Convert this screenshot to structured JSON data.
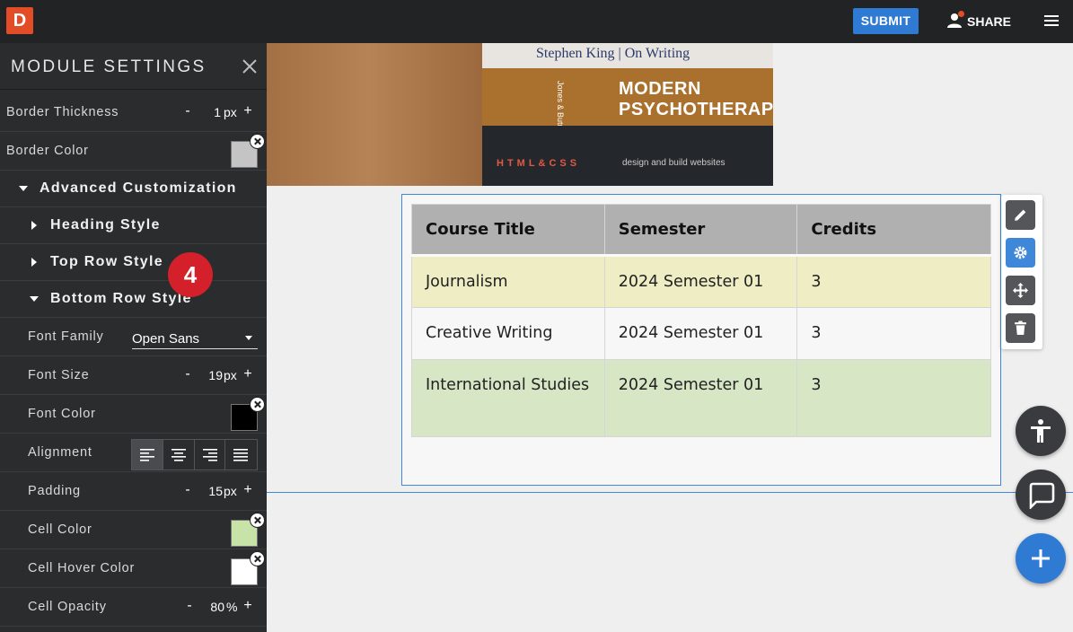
{
  "app": {
    "logo_letter": "D",
    "submit_label": "SUBMIT",
    "share_label": "SHARE"
  },
  "sidebar": {
    "title": "MODULE SETTINGS",
    "border_thickness": {
      "label": "Border Thickness",
      "value": "1",
      "unit": "px"
    },
    "border_color": {
      "label": "Border Color",
      "color": "#c4c4c4"
    },
    "advanced": "Advanced Customization",
    "heading_style": "Heading Style",
    "top_row_style": "Top Row Style",
    "bottom_row_style": "Bottom Row Style",
    "font_family": {
      "label": "Font Family",
      "value": "Open Sans"
    },
    "font_size": {
      "label": "Font Size",
      "value": "19",
      "unit": "px"
    },
    "font_color": {
      "label": "Font Color",
      "color": "#000000"
    },
    "alignment": {
      "label": "Alignment",
      "active": "left"
    },
    "padding": {
      "label": "Padding",
      "value": "15",
      "unit": "px"
    },
    "cell_color": {
      "label": "Cell Color",
      "color": "#c8e3a8"
    },
    "cell_hover_color": {
      "label": "Cell Hover Color",
      "color": "#ffffff"
    },
    "cell_opacity": {
      "label": "Cell Opacity",
      "value": "80",
      "unit": "%"
    },
    "step_badge": "4",
    "minus": "-",
    "plus": "+"
  },
  "hero": {
    "book1": "Stephen King | On Writing",
    "book2_line1": "MODERN",
    "book2_line2": "PSYCHOTHERAPI",
    "book2_author": "Jones & Butman",
    "book3_spine": "HTML&CSS",
    "book3_sub": "design and build websites"
  },
  "table": {
    "headers": [
      "Course Title",
      "Semester",
      "Credits"
    ],
    "rows": [
      [
        "Journalism",
        "2024 Semester 01",
        "3"
      ],
      [
        "Creative Writing",
        "2024 Semester 01",
        "3"
      ],
      [
        "International Studies",
        "2024 Semester 01",
        "3"
      ]
    ]
  },
  "colors": {
    "accent": "#2f7bd4",
    "header_bg": "#b0b0b0",
    "row1_bg": "#eeedc4",
    "row3_bg": "#d7e6c4",
    "badge": "#d4202a"
  },
  "icons": {
    "toolbar": [
      "pencil-icon",
      "gear-icon",
      "move-icon",
      "trash-icon"
    ],
    "fabs": [
      "accessibility-icon",
      "chat-icon",
      "plus-icon"
    ]
  }
}
